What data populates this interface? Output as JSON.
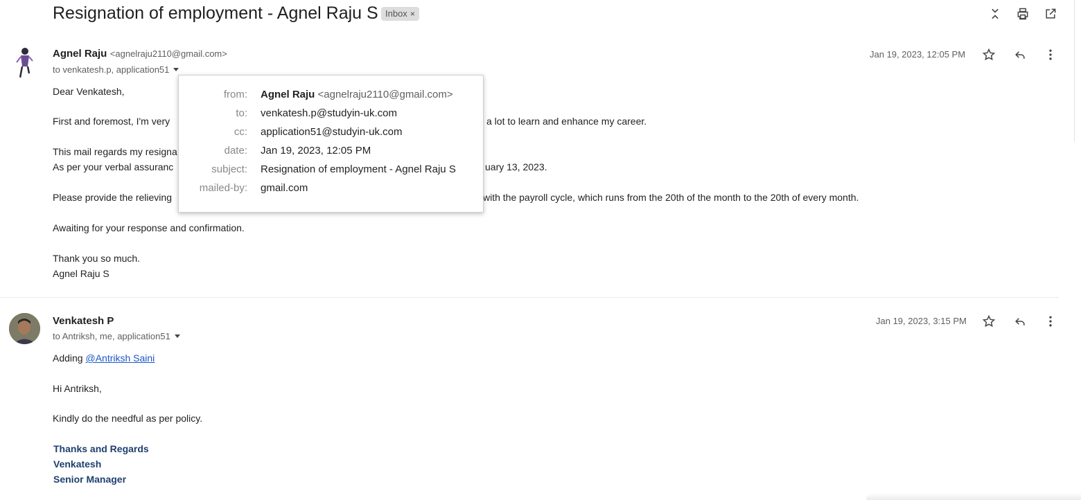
{
  "thread": {
    "subject": "Resignation of employment - Agnel Raju S",
    "label": "Inbox",
    "label_remove": "×",
    "toolbar_icons": [
      "collapse-all-icon",
      "print-icon",
      "open-in-new-window-icon"
    ]
  },
  "message1": {
    "sender_name": "Agnel Raju",
    "sender_email": "<agnelraju2110@gmail.com>",
    "to_line": "to venkatesh.p, application51",
    "date": "Jan 19, 2023, 12:05 PM",
    "body": {
      "greeting": "Dear Venkatesh,",
      "p1_left": "First and foremost, I'm very",
      "p1_right": "a lot to learn and enhance my career.",
      "p2_left": "This mail regards my resigna",
      "p3_left": "As per your verbal assuranc",
      "p3_right": "uary 13, 2023.",
      "p4_left": "Please provide the relieving",
      "p4_right": "with the payroll cycle, which runs from the 20th of the month to the 20th of every month.",
      "p5": "Awaiting for your response and confirmation.",
      "closing": "Thank you so much.",
      "signature": "Agnel Raju S"
    }
  },
  "details_popup": {
    "from_label": "from:",
    "from_name": "Agnel Raju",
    "from_email": "<agnelraju2110@gmail.com>",
    "to_label": "to:",
    "to_value": "venkatesh.p@studyin-uk.com",
    "cc_label": "cc:",
    "cc_value": "application51@studyin-uk.com",
    "date_label": "date:",
    "date_value": "Jan 19, 2023, 12:05 PM",
    "subject_label": "subject:",
    "subject_value": "Resignation of employment - Agnel Raju S",
    "mailedby_label": "mailed-by:",
    "mailedby_value": "gmail.com"
  },
  "message2": {
    "sender_name": "Venkatesh P",
    "to_line": "to Antriksh, me, application51",
    "date": "Jan 19, 2023, 3:15 PM",
    "body": {
      "adding": "Adding",
      "mention": "@Antriksh Saini",
      "greeting": "Hi Antriksh,",
      "p1": "Kindly do the needful as per policy.",
      "sig1": "Thanks and Regards",
      "sig2": "Venkatesh",
      "sig3": "Senior Manager"
    }
  },
  "colors": {
    "accent_link": "#1a57c6",
    "signature": "#1e3f6f",
    "label_chip": "#dddddd"
  }
}
